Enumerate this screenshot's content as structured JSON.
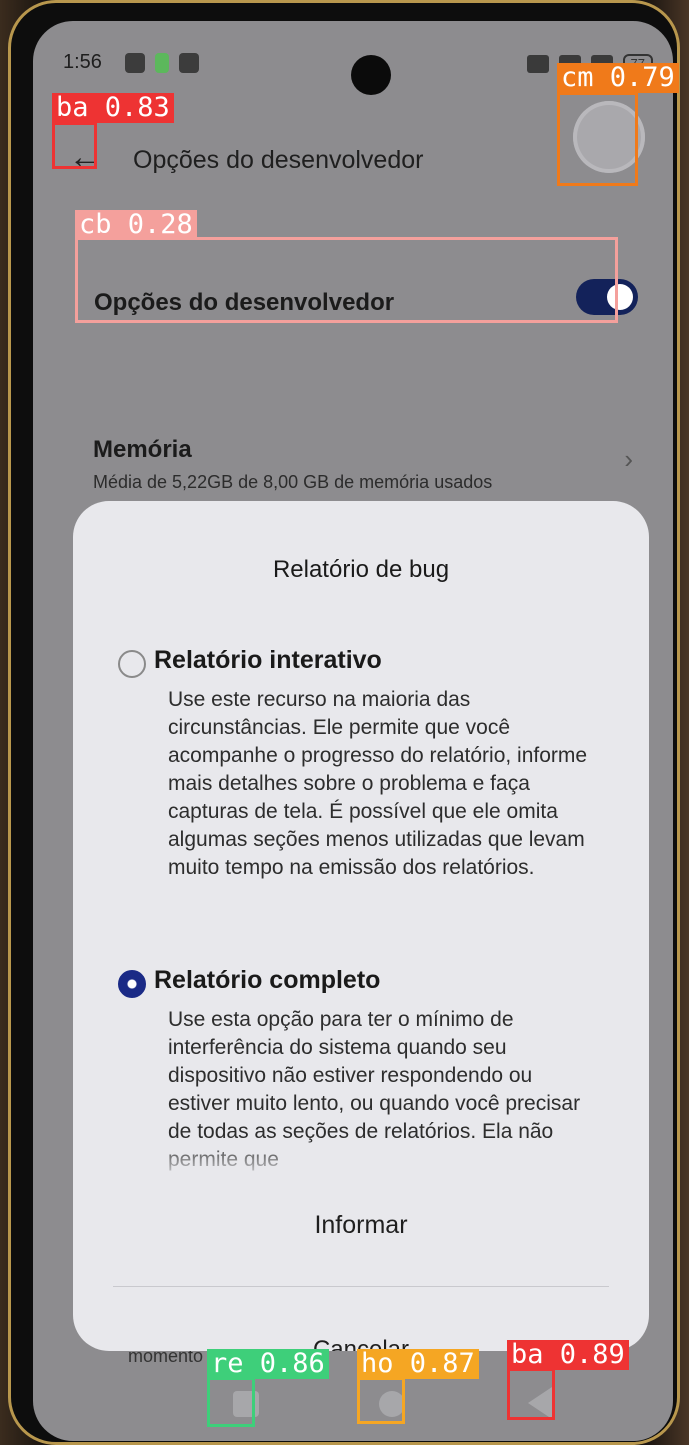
{
  "status_bar": {
    "time": "1:56",
    "battery": "77"
  },
  "header": {
    "title": "Opções do desenvolvedor",
    "back_icon": "arrow-left-icon"
  },
  "developer_row": {
    "label": "Opções do desenvolvedor",
    "toggle_on": true
  },
  "memory_row": {
    "title": "Memória",
    "subtitle": "Média de 5,22GB de 8,00 GB de memória usados"
  },
  "background_peek": {
    "text": "momento"
  },
  "dialog": {
    "title": "Relatório de bug",
    "options": [
      {
        "label": "Relatório interativo",
        "selected": false,
        "description": "Use este recurso na maioria das circunstâncias. Ele permite que você acompanhe o progresso do relatório, informe mais detalhes sobre o problema e faça capturas de tela. É possível que ele omita algumas seções menos utilizadas que levam muito tempo na emissão dos relatórios."
      },
      {
        "label": "Relatório completo",
        "selected": true,
        "description": "Use esta opção para ter o mínimo de interferência do sistema quando seu dispositivo não estiver respondendo ou estiver muito lento, ou quando você precisar de todas as seções de relatórios. Ela não permite que"
      }
    ],
    "inform_button": "Informar",
    "cancel_button": "Cancelar"
  },
  "nav_bar": {
    "recent_icon": "square-icon",
    "home_icon": "circle-icon",
    "back_icon": "triangle-back-icon"
  },
  "detections": [
    {
      "label": "ba 0.83",
      "color": "#ee3333"
    },
    {
      "label": "cm 0.79",
      "color": "#f07a1a"
    },
    {
      "label": "cb 0.28",
      "color": "#f4a09c"
    },
    {
      "label": "re 0.86",
      "color": "#3ecf7a"
    },
    {
      "label": "ho 0.87",
      "color": "#f5a623"
    },
    {
      "label": "ba 0.89",
      "color": "#ee3333"
    }
  ]
}
